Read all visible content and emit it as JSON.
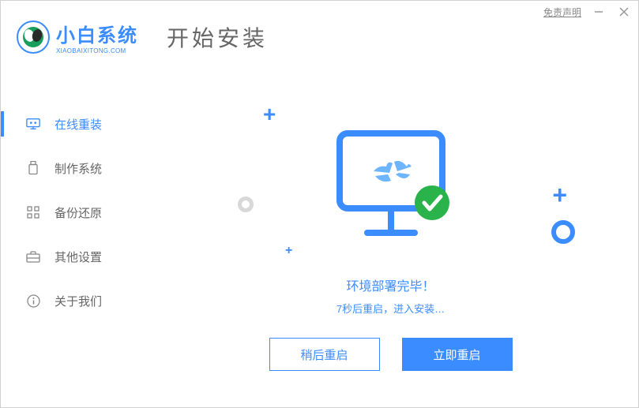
{
  "titlebar": {
    "disclaimer": "免责声明"
  },
  "logo": {
    "title": "小白系统",
    "subtitle": "XIAOBAIXITONG.COM"
  },
  "page_title": "开始安装",
  "sidebar": {
    "items": [
      {
        "label": "在线重装"
      },
      {
        "label": "制作系统"
      },
      {
        "label": "备份还原"
      },
      {
        "label": "其他设置"
      },
      {
        "label": "关于我们"
      }
    ]
  },
  "status": {
    "main": "环境部署完毕！",
    "sub": "7秒后重启，进入安装…"
  },
  "buttons": {
    "later": "稍后重启",
    "now": "立即重启"
  }
}
